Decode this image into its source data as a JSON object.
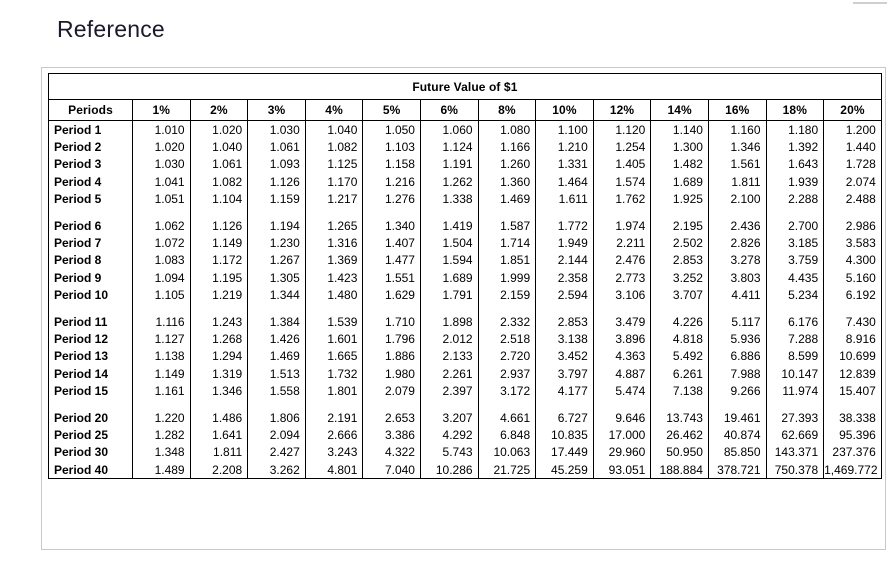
{
  "page": {
    "heading": "Reference"
  },
  "table": {
    "title": "Future Value of $1",
    "columns": [
      "Periods",
      "1%",
      "2%",
      "3%",
      "4%",
      "5%",
      "6%",
      "8%",
      "10%",
      "12%",
      "14%",
      "16%",
      "18%",
      "20%"
    ],
    "rate_headers": [
      "1%",
      "2%",
      "3%",
      "4%",
      "5%",
      "6%",
      "8%",
      "10%",
      "12%",
      "14%",
      "16%",
      "18%",
      "20%"
    ],
    "row_header_label": "Periods",
    "blocks": [
      {
        "rows": [
          {
            "label": "Period 1",
            "values": [
              "1.010",
              "1.020",
              "1.030",
              "1.040",
              "1.050",
              "1.060",
              "1.080",
              "1.100",
              "1.120",
              "1.140",
              "1.160",
              "1.180",
              "1.200"
            ]
          },
          {
            "label": "Period 2",
            "values": [
              "1.020",
              "1.040",
              "1.061",
              "1.082",
              "1.103",
              "1.124",
              "1.166",
              "1.210",
              "1.254",
              "1.300",
              "1.346",
              "1.392",
              "1.440"
            ]
          },
          {
            "label": "Period 3",
            "values": [
              "1.030",
              "1.061",
              "1.093",
              "1.125",
              "1.158",
              "1.191",
              "1.260",
              "1.331",
              "1.405",
              "1.482",
              "1.561",
              "1.643",
              "1.728"
            ]
          },
          {
            "label": "Period 4",
            "values": [
              "1.041",
              "1.082",
              "1.126",
              "1.170",
              "1.216",
              "1.262",
              "1.360",
              "1.464",
              "1.574",
              "1.689",
              "1.811",
              "1.939",
              "2.074"
            ]
          },
          {
            "label": "Period 5",
            "values": [
              "1.051",
              "1.104",
              "1.159",
              "1.217",
              "1.276",
              "1.338",
              "1.469",
              "1.611",
              "1.762",
              "1.925",
              "2.100",
              "2.288",
              "2.488"
            ]
          }
        ]
      },
      {
        "rows": [
          {
            "label": "Period 6",
            "values": [
              "1.062",
              "1.126",
              "1.194",
              "1.265",
              "1.340",
              "1.419",
              "1.587",
              "1.772",
              "1.974",
              "2.195",
              "2.436",
              "2.700",
              "2.986"
            ]
          },
          {
            "label": "Period 7",
            "values": [
              "1.072",
              "1.149",
              "1.230",
              "1.316",
              "1.407",
              "1.504",
              "1.714",
              "1.949",
              "2.211",
              "2.502",
              "2.826",
              "3.185",
              "3.583"
            ]
          },
          {
            "label": "Period 8",
            "values": [
              "1.083",
              "1.172",
              "1.267",
              "1.369",
              "1.477",
              "1.594",
              "1.851",
              "2.144",
              "2.476",
              "2.853",
              "3.278",
              "3.759",
              "4.300"
            ]
          },
          {
            "label": "Period 9",
            "values": [
              "1.094",
              "1.195",
              "1.305",
              "1.423",
              "1.551",
              "1.689",
              "1.999",
              "2.358",
              "2.773",
              "3.252",
              "3.803",
              "4.435",
              "5.160"
            ]
          },
          {
            "label": "Period 10",
            "values": [
              "1.105",
              "1.219",
              "1.344",
              "1.480",
              "1.629",
              "1.791",
              "2.159",
              "2.594",
              "3.106",
              "3.707",
              "4.411",
              "5.234",
              "6.192"
            ]
          }
        ]
      },
      {
        "rows": [
          {
            "label": "Period 11",
            "values": [
              "1.116",
              "1.243",
              "1.384",
              "1.539",
              "1.710",
              "1.898",
              "2.332",
              "2.853",
              "3.479",
              "4.226",
              "5.117",
              "6.176",
              "7.430"
            ]
          },
          {
            "label": "Period 12",
            "values": [
              "1.127",
              "1.268",
              "1.426",
              "1.601",
              "1.796",
              "2.012",
              "2.518",
              "3.138",
              "3.896",
              "4.818",
              "5.936",
              "7.288",
              "8.916"
            ]
          },
          {
            "label": "Period 13",
            "values": [
              "1.138",
              "1.294",
              "1.469",
              "1.665",
              "1.886",
              "2.133",
              "2.720",
              "3.452",
              "4.363",
              "5.492",
              "6.886",
              "8.599",
              "10.699"
            ]
          },
          {
            "label": "Period 14",
            "values": [
              "1.149",
              "1.319",
              "1.513",
              "1.732",
              "1.980",
              "2.261",
              "2.937",
              "3.797",
              "4.887",
              "6.261",
              "7.988",
              "10.147",
              "12.839"
            ]
          },
          {
            "label": "Period 15",
            "values": [
              "1.161",
              "1.346",
              "1.558",
              "1.801",
              "2.079",
              "2.397",
              "3.172",
              "4.177",
              "5.474",
              "7.138",
              "9.266",
              "11.974",
              "15.407"
            ]
          }
        ]
      },
      {
        "rows": [
          {
            "label": "Period 20",
            "values": [
              "1.220",
              "1.486",
              "1.806",
              "2.191",
              "2.653",
              "3.207",
              "4.661",
              "6.727",
              "9.646",
              "13.743",
              "19.461",
              "27.393",
              "38.338"
            ]
          },
          {
            "label": "Period 25",
            "values": [
              "1.282",
              "1.641",
              "2.094",
              "2.666",
              "3.386",
              "4.292",
              "6.848",
              "10.835",
              "17.000",
              "26.462",
              "40.874",
              "62.669",
              "95.396"
            ]
          },
          {
            "label": "Period 30",
            "values": [
              "1.348",
              "1.811",
              "2.427",
              "3.243",
              "4.322",
              "5.743",
              "10.063",
              "17.449",
              "29.960",
              "50.950",
              "85.850",
              "143.371",
              "237.376"
            ]
          },
          {
            "label": "Period 40",
            "values": [
              "1.489",
              "2.208",
              "3.262",
              "4.801",
              "7.040",
              "10.286",
              "21.725",
              "45.259",
              "93.051",
              "188.884",
              "378.721",
              "750.378",
              "1,469.772"
            ]
          }
        ]
      }
    ]
  },
  "colors": {
    "text": "#000000",
    "heading": "#1a1a2e",
    "border": "#000000",
    "frame": "#c8c8c8",
    "background": "#ffffff"
  }
}
